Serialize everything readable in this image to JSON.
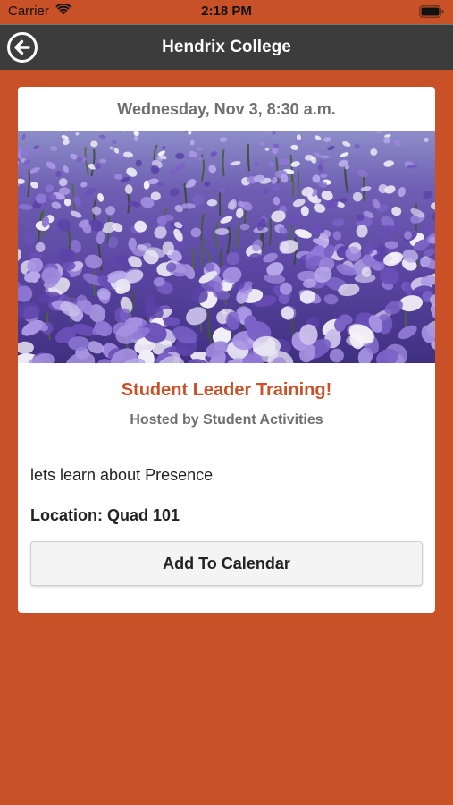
{
  "status_bar": {
    "carrier": "Carrier",
    "time": "2:18 PM",
    "wifi_icon": "wifi-icon",
    "battery_icon": "battery-icon"
  },
  "nav": {
    "title": "Hendrix College",
    "back_icon": "back-arrow-circle-icon"
  },
  "event": {
    "date": "Wednesday, Nov 3, 8:30 a.m.",
    "title": "Student Leader Training!",
    "host": "Hosted by Student Activities",
    "description": "lets learn about Presence",
    "location": "Location: Quad 101",
    "add_to_calendar_label": "Add To Calendar"
  },
  "colors": {
    "background": "#c95128",
    "nav_bar": "#3c3c3c",
    "accent": "#c95128",
    "card": "#ffffff",
    "muted_text": "#6f6f6f"
  }
}
